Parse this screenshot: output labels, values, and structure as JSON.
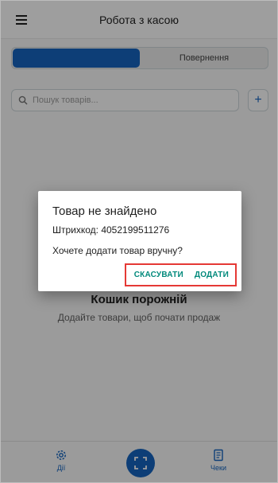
{
  "app_bar": {
    "title": "Робота з касою",
    "menu_icon": "menu-icon"
  },
  "tabs": [
    {
      "label": "",
      "active": true
    },
    {
      "label": "Повернення",
      "active": false
    }
  ],
  "search": {
    "placeholder": "Пошук товарів...",
    "value": "",
    "icon": "search-icon"
  },
  "add_button": {
    "icon": "plus-icon"
  },
  "empty_state": {
    "title": "Кошик порожній",
    "subtitle": "Додайте товари, щоб почати продаж"
  },
  "dialog": {
    "title": "Товар не знайдено",
    "barcode_line": "Штрихкод: 4052199511276",
    "question": "Хочете додати товар вручну?",
    "cancel_label": "СКАСУВАТИ",
    "add_label": "ДОДАТИ"
  },
  "bottom_nav": {
    "actions_label": "Дії",
    "receipts_label": "Чеки",
    "scan_icon": "scan-icon"
  },
  "colors": {
    "primary": "#1565c0",
    "accent": "#00897b",
    "highlight": "#e53935"
  }
}
